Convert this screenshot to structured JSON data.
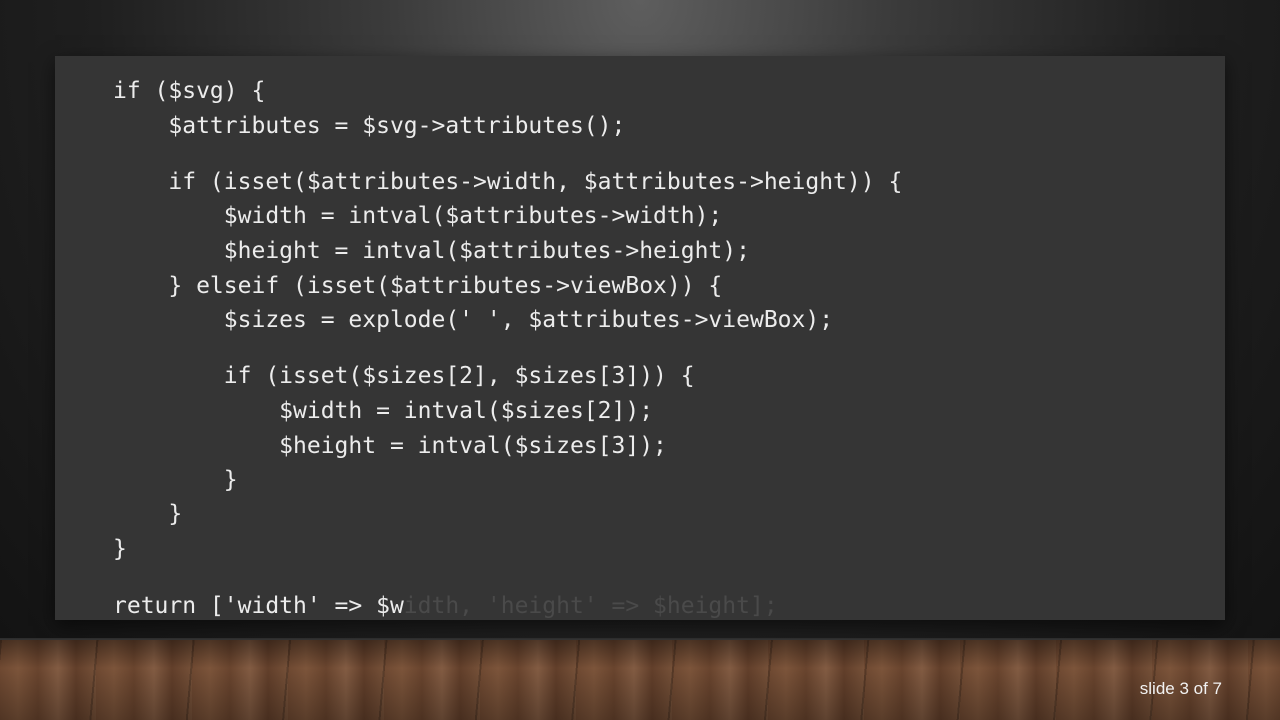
{
  "code": {
    "lines": [
      "if ($svg) {",
      "    $attributes = $svg->attributes();",
      "    if (isset($attributes->width, $attributes->height)) {",
      "        $width = intval($attributes->width);",
      "        $height = intval($attributes->height);",
      "    } elseif (isset($attributes->viewBox)) {",
      "        $sizes = explode(' ', $attributes->viewBox);",
      "        if (isset($sizes[2], $sizes[3])) {",
      "            $width = intval($sizes[2]);",
      "            $height = intval($sizes[3]);",
      "        }",
      "    }",
      "}"
    ],
    "return_visible": "return ['width' => $w",
    "return_faded": "idth, 'height' => $height];"
  },
  "footer": {
    "slide_counter": "slide 3 of 7"
  }
}
